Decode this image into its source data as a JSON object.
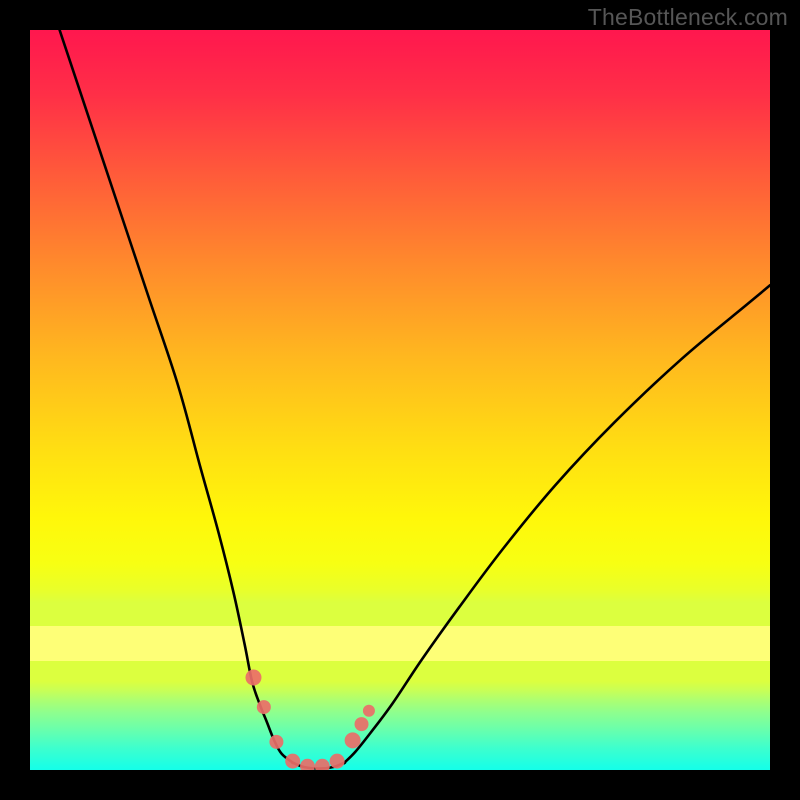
{
  "attribution": "TheBottleneck.com",
  "colors": {
    "frame": "#000000",
    "attribution_text": "#565656",
    "marker": "#ea6e68"
  },
  "chart_data": {
    "type": "line",
    "title": "",
    "xlabel": "",
    "ylabel": "",
    "xlim": [
      0,
      100
    ],
    "ylim": [
      0,
      100
    ],
    "series": [
      {
        "name": "left-branch",
        "x": [
          4,
          8,
          12,
          16,
          20,
          23,
          25.5,
          27.5,
          29,
          30,
          31,
          32,
          33,
          34,
          35.5
        ],
        "y": [
          100,
          88,
          76,
          64,
          52,
          41,
          32,
          24,
          17,
          12,
          9,
          6.5,
          4,
          2.2,
          1
        ]
      },
      {
        "name": "trough",
        "x": [
          35.5,
          37,
          39,
          41,
          42.5
        ],
        "y": [
          1,
          0.4,
          0.2,
          0.4,
          1
        ]
      },
      {
        "name": "right-branch",
        "x": [
          42.5,
          44,
          46,
          49,
          53,
          58,
          64,
          71,
          79,
          88,
          97,
          100
        ],
        "y": [
          1,
          2.5,
          5,
          9,
          15,
          22,
          30,
          38.5,
          47,
          55.5,
          63,
          65.5
        ]
      }
    ],
    "markers": {
      "name": "highlighted-points",
      "x": [
        30.2,
        31.6,
        33.3,
        35.5,
        37.5,
        39.5,
        41.5,
        43.6,
        44.8,
        45.8
      ],
      "y": [
        12.5,
        8.5,
        3.8,
        1.2,
        0.5,
        0.5,
        1.2,
        4.0,
        6.2,
        8.0
      ],
      "r": [
        8,
        7,
        7,
        7.5,
        7.5,
        7.5,
        7.5,
        8,
        7,
        6
      ]
    }
  }
}
